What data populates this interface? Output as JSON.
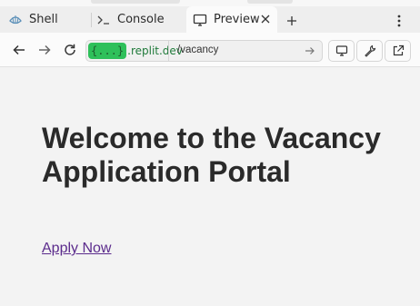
{
  "tabs": [
    {
      "label": "Shell",
      "icon": "shell-icon"
    },
    {
      "label": "Console",
      "icon": "terminal-icon"
    },
    {
      "label": "Preview",
      "icon": "monitor-icon",
      "active": true
    }
  ],
  "nav": {
    "domain_badge": "{...}",
    "domain": ".replit.dev",
    "path": "/vacancy"
  },
  "page": {
    "heading": "Welcome to the Vacancy Application Portal",
    "apply_link": "Apply Now"
  },
  "colors": {
    "link": "#5b2b8c",
    "domain_badge": "#2ec05a",
    "domain_text": "#1f7a3a"
  }
}
